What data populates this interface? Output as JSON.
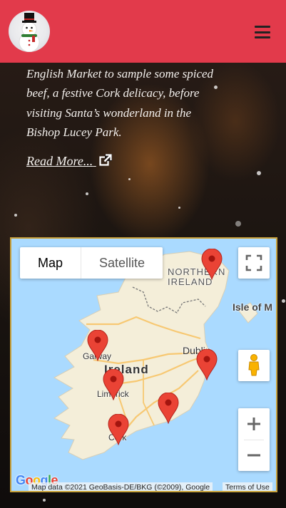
{
  "header": {
    "logo_icon": "snowman-logo-icon",
    "menu_icon": "hamburger-menu-icon",
    "brand_color": "#e23a4b"
  },
  "content": {
    "intro_lines": [
      "English Market to sample some spiced",
      "beef, a festive Cork delicacy, before",
      "visiting Santa’s wonderland in the",
      "Bishop Lucey Park."
    ],
    "read_more_label": "Read More...",
    "read_more_icon": "external-link-icon"
  },
  "map": {
    "type_controls": {
      "map_label": "Map",
      "satellite_label": "Satellite",
      "selected": "Map"
    },
    "labels": {
      "northern_ireland": "NORTHERN\nIRELAND",
      "northern_ireland_l1": "NORTHERN",
      "northern_ireland_l2": "IRELAND",
      "isle_of_man": "Isle of M",
      "dublin": "Dublin",
      "ireland": "Ireland",
      "galway": "Galway",
      "limerick": "Limerick",
      "cork": "Cork"
    },
    "markers": [
      {
        "name": "belfast-marker"
      },
      {
        "name": "galway-marker"
      },
      {
        "name": "limerick-marker"
      },
      {
        "name": "dublin-marker"
      },
      {
        "name": "waterford-marker"
      },
      {
        "name": "cork-marker"
      }
    ],
    "marker_color": "#ea4335",
    "controls": {
      "fullscreen_icon": "fullscreen-icon",
      "pegman_icon": "pegman-street-view-icon",
      "zoom_in": "+",
      "zoom_out": "−"
    },
    "google_logo": "Google",
    "attribution": "Map data ©2021 GeoBasis-DE/BKG (©2009), Google",
    "terms": "Terms of Use"
  }
}
